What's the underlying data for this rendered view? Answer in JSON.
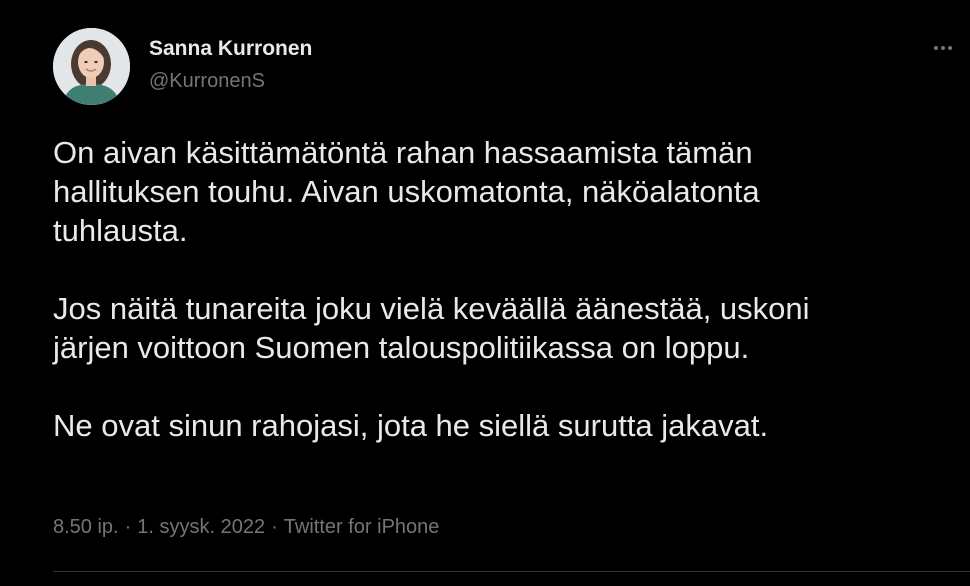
{
  "tweet": {
    "author_name": "Sanna Kurronen",
    "author_handle": "@KurronenS",
    "more_icon": "more-horizontal-icon",
    "paragraphs": [
      "On aivan käsittämätöntä rahan hassaamista tämän\nhallituksen touhu. Aivan uskomatonta, näköalatonta\ntuhlausta.",
      "Jos näitä tunareita joku vielä keväällä äänestää, uskoni\njärjen voittoon Suomen talouspolitiikassa on loppu.",
      "Ne ovat sinun rahojasi, jota he siellä surutta jakavat."
    ],
    "time": "8.50 ip.",
    "separator": "·",
    "date": "1. syysk. 2022",
    "source": "Twitter for iPhone"
  },
  "colors": {
    "background": "#000000",
    "primary_text": "#e7e9ea",
    "secondary_text": "#71767b",
    "divider": "#2f3336"
  }
}
